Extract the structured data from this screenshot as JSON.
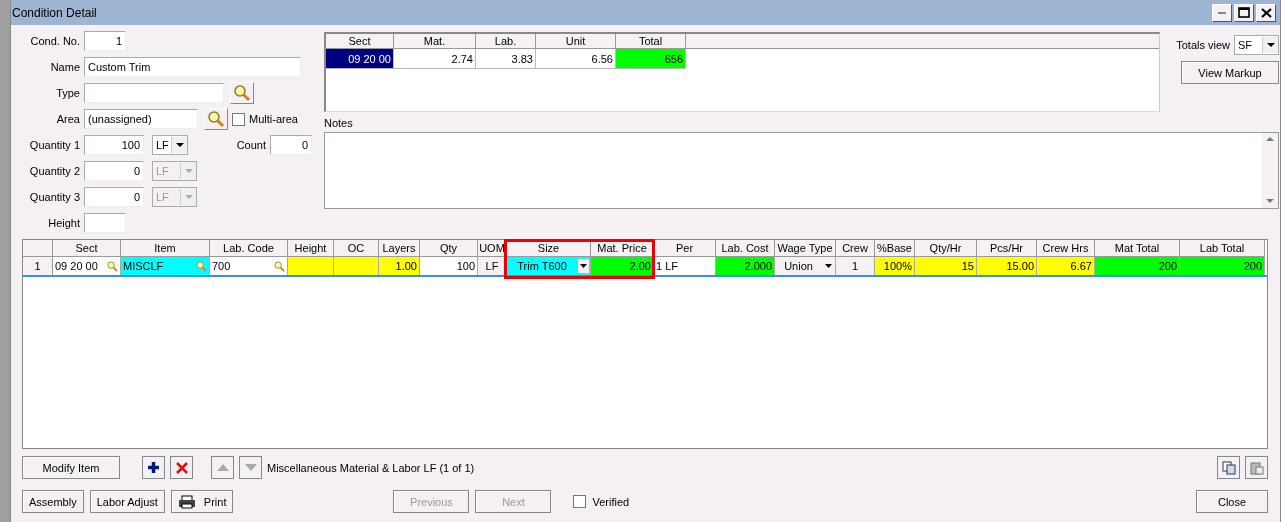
{
  "window": {
    "title": "Condition Detail"
  },
  "form": {
    "cond_no": {
      "label": "Cond. No.",
      "value": "1"
    },
    "name": {
      "label": "Name",
      "value": "Custom Trim"
    },
    "type": {
      "label": "Type"
    },
    "area": {
      "label": "Area",
      "value": "(unassigned)"
    },
    "multi_area": {
      "label": "Multi-area",
      "checked": false
    },
    "quantities": [
      {
        "label": "Quantity 1",
        "value": "100",
        "unit": "LF",
        "disabled": false
      },
      {
        "label": "Quantity 2",
        "value": "0",
        "unit": "LF",
        "disabled": true
      },
      {
        "label": "Quantity 3",
        "value": "0",
        "unit": "LF",
        "disabled": true
      }
    ],
    "count": {
      "label": "Count",
      "value": "0"
    },
    "height": {
      "label": "Height"
    }
  },
  "summary": {
    "columns": [
      "Sect",
      "Mat.",
      "Lab.",
      "Unit",
      "Total"
    ],
    "cells": [
      {
        "text": "09 20 00",
        "selected": true
      },
      {
        "text": "2.74",
        "selected": false,
        "color": "#ffffff"
      },
      {
        "text": "3.83",
        "selected": false,
        "color": "#ffffff"
      },
      {
        "text": "6.56",
        "selected": false,
        "color": "#ffffff"
      },
      {
        "text": "656",
        "selected": false,
        "color": "#00ff00"
      }
    ]
  },
  "notes": {
    "label": "Notes"
  },
  "totals_view": {
    "label": "Totals view",
    "value": "SF"
  },
  "view_markup_button": "View Markup",
  "grid": {
    "columns": [
      {
        "label": "Sect",
        "boxed": false
      },
      {
        "label": "Item",
        "boxed": false
      },
      {
        "label": "Lab. Code",
        "boxed": false
      },
      {
        "label": "Height",
        "boxed": false
      },
      {
        "label": "OC",
        "boxed": false
      },
      {
        "label": "Layers",
        "boxed": false
      },
      {
        "label": "Qty",
        "boxed": false
      },
      {
        "label": "UOM",
        "boxed": false
      },
      {
        "label": "Size",
        "boxed": true
      },
      {
        "label": "Mat. Price",
        "boxed": true
      },
      {
        "label": "Per",
        "boxed": false
      },
      {
        "label": "Lab. Cost",
        "boxed": false
      },
      {
        "label": "Wage Type",
        "boxed": false
      },
      {
        "label": "Crew",
        "boxed": false
      },
      {
        "label": "%Base",
        "boxed": false
      },
      {
        "label": "Qty/Hr",
        "boxed": false
      },
      {
        "label": "Pcs/Hr",
        "boxed": false
      },
      {
        "label": "Crew Hrs",
        "boxed": false
      },
      {
        "label": "Mat Total",
        "boxed": false
      },
      {
        "label": "Lab Total",
        "boxed": false
      }
    ],
    "rows": [
      {
        "number": "1",
        "cells": [
          {
            "text": "09 20 00",
            "kind": "lookup",
            "color": "#ffffff"
          },
          {
            "text": "MISCLF",
            "kind": "lookup",
            "color": "#00ffff"
          },
          {
            "text": "700",
            "kind": "lookup",
            "color": "#ffffff"
          },
          {
            "kind": "plain",
            "color": "#ffff00"
          },
          {
            "kind": "plain",
            "color": "#ffff00"
          },
          {
            "text": "1.00",
            "kind": "plain",
            "color": "#ffff00"
          },
          {
            "text": "100",
            "kind": "plain",
            "color": "#ffffff"
          },
          {
            "text": "LF",
            "kind": "plain",
            "color": "#f4f0f4"
          },
          {
            "text": "Trim T600",
            "kind": "dropdown",
            "color": "#00ffff"
          },
          {
            "text": "2.00",
            "kind": "plain",
            "color": "#00ff00"
          },
          {
            "text": "1 LF",
            "kind": "plain",
            "color": "#ffffff"
          },
          {
            "text": "2.000",
            "kind": "plain",
            "color": "#00ff00"
          },
          {
            "text": "Union",
            "kind": "dropdown",
            "color": "#f4f0f4"
          },
          {
            "text": "1",
            "kind": "plain",
            "color": "#f4f0f4"
          },
          {
            "text": "100%",
            "kind": "plain",
            "color": "#ffff00"
          },
          {
            "text": "15",
            "kind": "plain",
            "color": "#ffff00"
          },
          {
            "text": "15.00",
            "kind": "plain",
            "color": "#ffff00"
          },
          {
            "text": "6.67",
            "kind": "plain",
            "color": "#ffff00"
          },
          {
            "text": "200",
            "kind": "plain",
            "color": "#00ff00"
          },
          {
            "text": "200",
            "kind": "plain",
            "color": "#00ff00"
          }
        ]
      }
    ]
  },
  "item_toolbar": {
    "modify_button": "Modify Item",
    "description": "Miscellaneous Material & Labor LF (1 of 1)"
  },
  "buttons": [
    {
      "label": "Assembly",
      "kind": "plain",
      "disabled": false
    },
    {
      "label": "Labor Adjust",
      "kind": "plain",
      "disabled": false
    },
    {
      "label": "Print",
      "kind": "print",
      "disabled": false
    }
  ],
  "nav_buttons": [
    {
      "label": "Previous",
      "disabled": true
    },
    {
      "label": "Next",
      "disabled": true
    }
  ],
  "verified": {
    "label": "Verified",
    "checked": false
  },
  "close_button": "Close"
}
